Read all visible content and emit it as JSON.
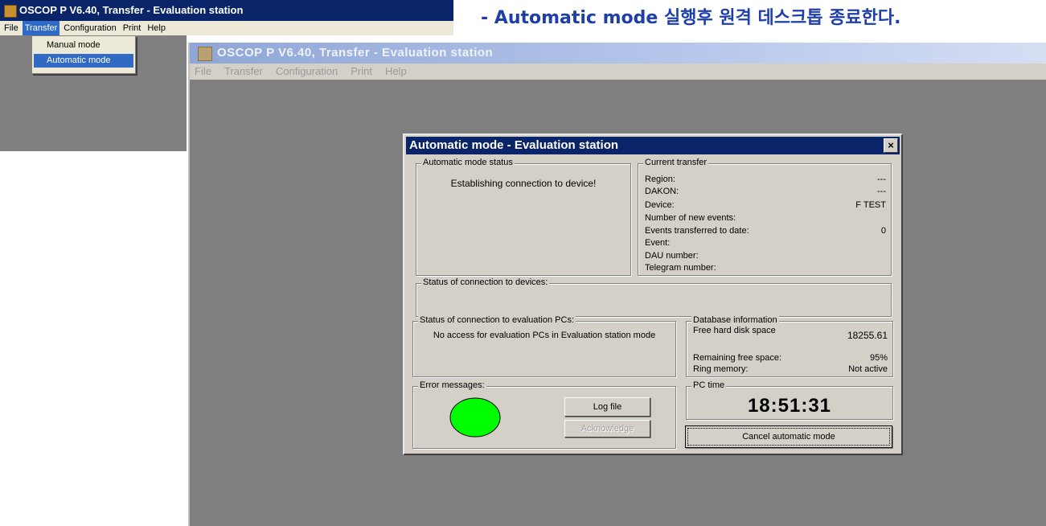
{
  "small_window": {
    "title": "OSCOP P V6.40, Transfer - Evaluation station",
    "menu": [
      "File",
      "Transfer",
      "Configuration",
      "Print",
      "Help"
    ],
    "dropdown": [
      "Manual mode",
      "Automatic mode"
    ]
  },
  "headline": "- Automatic mode 실행후 원격 데스크톱 종료한다.",
  "big_window": {
    "title": "OSCOP P V6.40, Transfer - Evaluation station",
    "menu": [
      "File",
      "Transfer",
      "Configuration",
      "Print",
      "Help"
    ]
  },
  "dialog": {
    "title": "Automatic mode - Evaluation station",
    "close_glyph": "×",
    "auto_status": {
      "legend": "Automatic mode status",
      "text": "Establishing connection to device!"
    },
    "current_transfer": {
      "legend": "Current transfer",
      "rows": [
        {
          "k": "Region:",
          "v": "---"
        },
        {
          "k": "DAKON:",
          "v": "---"
        },
        {
          "k": "Device:",
          "v": "F TEST"
        },
        {
          "k": "Number of new events:",
          "v": ""
        },
        {
          "k": "Events transferred to date:",
          "v": "0"
        },
        {
          "k": "Event:",
          "v": ""
        },
        {
          "k": "DAU number:",
          "v": ""
        },
        {
          "k": "Telegram number:",
          "v": ""
        }
      ]
    },
    "devices_status": {
      "legend": "Status of connection to devices:"
    },
    "eval_pcs": {
      "legend": "Status of connection to evaluation PCs:",
      "text": "No access for evaluation PCs in Evaluation station mode"
    },
    "database": {
      "legend": "Database information",
      "free_disk_label": "Free hard disk space",
      "free_disk_value": "18255.61",
      "remaining_label": "Remaining free space:",
      "remaining_value": "95%",
      "ring_label": "Ring memory:",
      "ring_value": "Not active"
    },
    "errors": {
      "legend": "Error messages:",
      "indicator_color": "#00ff00",
      "log_file_label": "Log file",
      "acknowledge_label": "Acknowledge"
    },
    "pc_time": {
      "legend": "PC time",
      "time": "18:51:31"
    },
    "cancel_label": "Cancel automatic mode"
  }
}
